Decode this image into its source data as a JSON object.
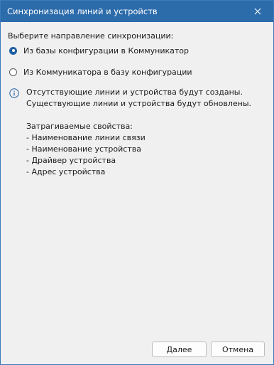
{
  "window": {
    "title": "Синхронизация линий и устройств"
  },
  "sync": {
    "prompt": "Выберите направление синхронизации:",
    "options": [
      {
        "label": "Из базы конфигурации в Коммуникатор",
        "selected": true
      },
      {
        "label": "Из Коммуникатора в базу конфигурации",
        "selected": false
      }
    ]
  },
  "info": {
    "icon": "info-icon",
    "lines": [
      "Отсутствующие линии и устройства будут созданы.",
      "Существующие линии и устройства будут обновлены."
    ],
    "affected_title": "Затрагиваемые свойства:",
    "affected_items": [
      "- Наименование линии связи",
      "- Наименование устройства",
      "- Драйвер устройства",
      "- Адрес устройства"
    ]
  },
  "buttons": {
    "next": "Далее",
    "cancel": "Отмена"
  },
  "colors": {
    "titlebar": "#2d6cab",
    "accent": "#1f5fa3",
    "background": "#f0f0f0"
  }
}
